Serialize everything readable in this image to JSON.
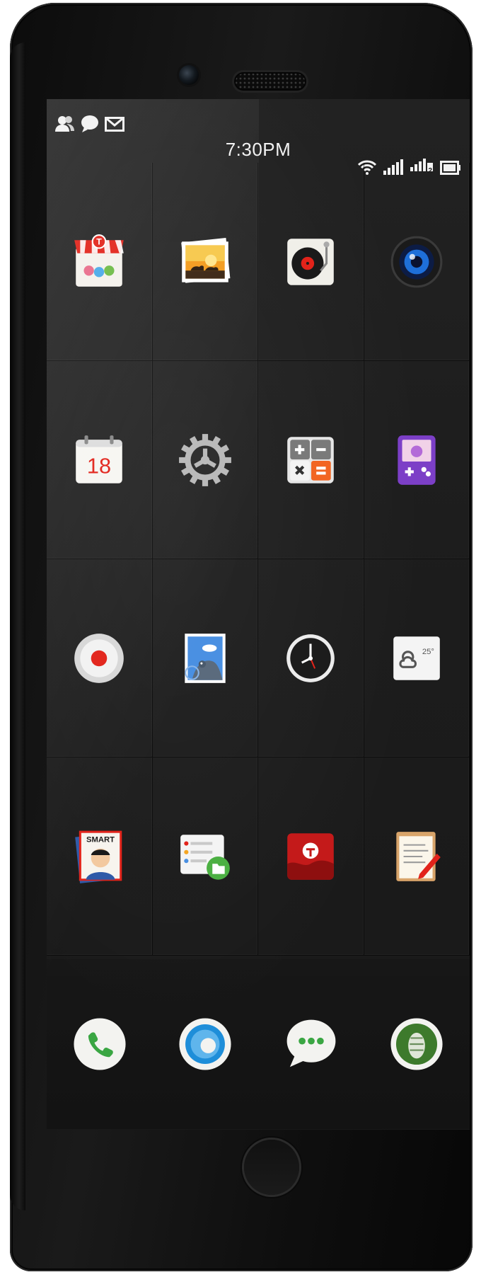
{
  "status_bar": {
    "time": "7:30PM",
    "left_icons": [
      "contacts-icon",
      "message-icon",
      "mail-icon"
    ],
    "right_icons": [
      "wifi-icon",
      "signal-1-icon",
      "signal-2-icon",
      "battery-icon"
    ],
    "sim2_label": "2"
  },
  "apps": [
    {
      "name": "app-store",
      "icon": "store-icon"
    },
    {
      "name": "gallery",
      "icon": "gallery-icon"
    },
    {
      "name": "music",
      "icon": "turntable-icon"
    },
    {
      "name": "camera",
      "icon": "camera-lens-icon"
    },
    {
      "name": "calendar",
      "icon": "calendar-icon",
      "day": "18"
    },
    {
      "name": "settings",
      "icon": "gear-icon"
    },
    {
      "name": "calculator",
      "icon": "calculator-icon"
    },
    {
      "name": "game-center",
      "icon": "game-console-icon"
    },
    {
      "name": "recorder",
      "icon": "record-icon"
    },
    {
      "name": "mail",
      "icon": "stamp-icon"
    },
    {
      "name": "clock",
      "icon": "clock-icon"
    },
    {
      "name": "weather",
      "icon": "weather-icon",
      "temp": "25°"
    },
    {
      "name": "contacts-card",
      "icon": "contact-card-icon",
      "label": "SMART"
    },
    {
      "name": "file-manager",
      "icon": "files-icon"
    },
    {
      "name": "news",
      "icon": "news-icon"
    },
    {
      "name": "notes",
      "icon": "notepad-icon"
    }
  ],
  "dock": [
    {
      "name": "phone",
      "icon": "phone-icon"
    },
    {
      "name": "browser",
      "icon": "browser-icon"
    },
    {
      "name": "messages",
      "icon": "chat-icon"
    },
    {
      "name": "wallet",
      "icon": "badge-icon"
    }
  ],
  "colors": {
    "screen_bg": "#1e1e1e",
    "accent_red": "#e2231a",
    "accent_blue": "#1e6fd9",
    "accent_green": "#4cb043"
  }
}
